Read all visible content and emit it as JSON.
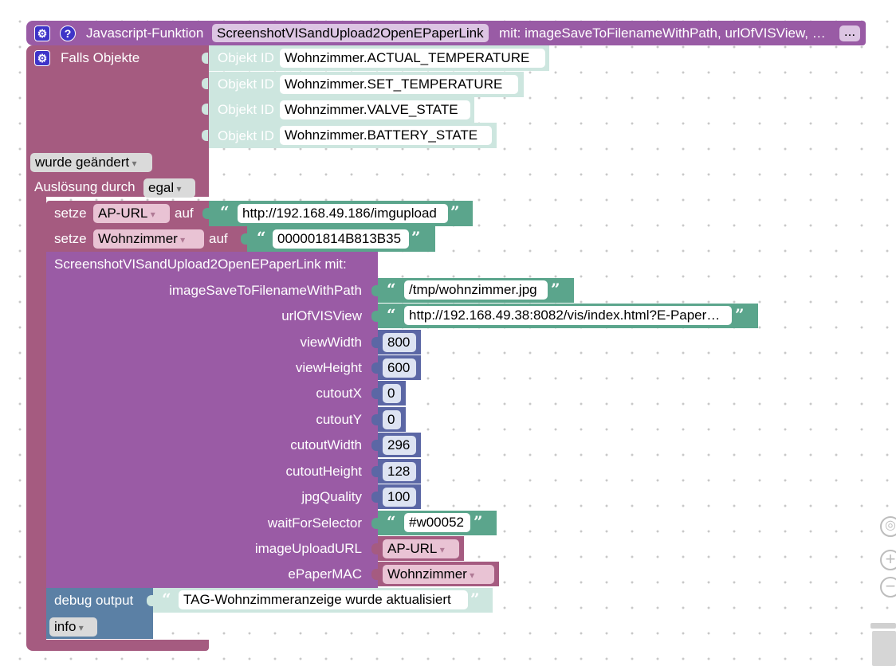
{
  "function_def": {
    "header": "Javascript-Funktion",
    "name": "ScreenshotVISandUpload2OpenEPaperLink",
    "params_text": "mit: imageSaveToFilenameWithPath, urlOfVISView, …",
    "more": "..."
  },
  "trigger": {
    "label": "Falls Objekte",
    "object_id_label": "Objekt ID",
    "objects": [
      "Wohnzimmer.ACTUAL_TEMPERATURE",
      "Wohnzimmer.SET_TEMPERATURE",
      "Wohnzimmer.VALVE_STATE",
      "Wohnzimmer.BATTERY_STATE"
    ],
    "condition": "wurde geändert",
    "trigger_by_label": "Auslösung durch",
    "trigger_by": "egal"
  },
  "statements": {
    "set1": {
      "keyword": "setze",
      "var": "AP-URL",
      "auf": "auf",
      "value": "http://192.168.49.186/imgupload"
    },
    "set2": {
      "keyword": "setze",
      "var": "Wohnzimmer",
      "auf": "auf",
      "value": "000001814B813B35"
    },
    "call": {
      "name": "ScreenshotVISandUpload2OpenEPaperLink",
      "mit": "mit:",
      "params": {
        "imageSaveToFilenameWithPath": {
          "label": "imageSaveToFilenameWithPath",
          "value": "/tmp/wohnzimmer.jpg"
        },
        "urlOfVISView": {
          "label": "urlOfVISView",
          "value": "http://192.168.49.38:8082/vis/index.html?E-Paper…"
        },
        "viewWidth": {
          "label": "viewWidth",
          "value": "800"
        },
        "viewHeight": {
          "label": "viewHeight",
          "value": "600"
        },
        "cutoutX": {
          "label": "cutoutX",
          "value": "0"
        },
        "cutoutY": {
          "label": "cutoutY",
          "value": "0"
        },
        "cutoutWidth": {
          "label": "cutoutWidth",
          "value": "296"
        },
        "cutoutHeight": {
          "label": "cutoutHeight",
          "value": "128"
        },
        "jpgQuality": {
          "label": "jpgQuality",
          "value": "100"
        },
        "waitForSelector": {
          "label": "waitForSelector",
          "value": "#w00052"
        },
        "imageUploadURL": {
          "label": "imageUploadURL",
          "value": "AP-URL"
        },
        "ePaperMAC": {
          "label": "ePaperMAC",
          "value": "Wohnzimmer"
        }
      }
    },
    "debug": {
      "label": "debug output",
      "message": "TAG-Wohnzimmeranzeige wurde aktualisiert",
      "level": "info"
    }
  },
  "icons": {
    "gear": "⚙",
    "help": "?",
    "open_quote": "“",
    "close_quote": "”",
    "zoom_reset": "◎",
    "zoom_in": "+",
    "zoom_out": "−",
    "trash": "trash-icon"
  },
  "colors": {
    "function_block": "#995ba5",
    "trigger_block": "#a55b80",
    "variable_block": "#a55b80",
    "procedure_call": "#9a5ba5",
    "text_block": "#5ba58c",
    "light_text_block": "#cde6df",
    "number_block": "#5b67a5",
    "debug_block": "#5b80a5",
    "icon_button": "#3e34c8"
  }
}
